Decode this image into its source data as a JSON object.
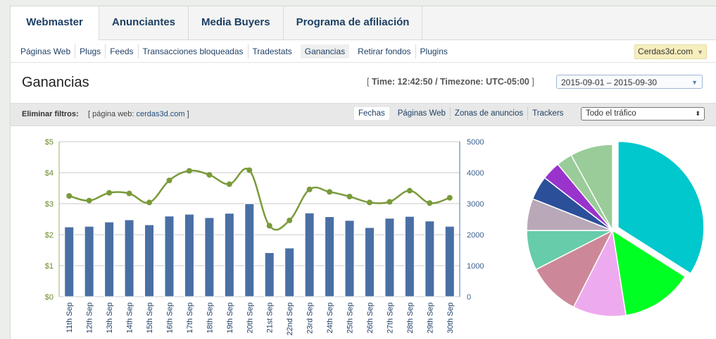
{
  "main_tabs": [
    "Webmaster",
    "Anunciantes",
    "Media Buyers",
    "Programa de afiliación"
  ],
  "sub_nav": [
    "Páginas Web",
    "Plugs",
    "Feeds",
    "Transacciones bloqueadas",
    "Tradestats",
    "Ganancias",
    "Retirar fondos",
    "Plugins"
  ],
  "sub_nav_active": "Ganancias",
  "domain_select": "Cerdas3d.com",
  "page_title": "Ganancias",
  "time_info": {
    "open": "[",
    "text": "Time: 12:42:50 / Timezone: UTC-05:00",
    "close": "]"
  },
  "date_range": "2015-09-01 – 2015-09-30",
  "filters": {
    "label": "Eliminar filtros:",
    "prefix": "[ página web:",
    "value": "cerdas3d.com",
    "suffix": "]"
  },
  "view_tabs": [
    "Fechas",
    "Páginas Web",
    "Zonas de anuncios",
    "Trackers"
  ],
  "traffic_select": "Todo el tráfico",
  "colors": {
    "bar": "#4a6fa5",
    "line": "#7a9a3a",
    "accent": "#1d3f63"
  },
  "chart_data": [
    {
      "type": "bar",
      "categories": [
        "11th Sep",
        "12th Sep",
        "13th Sep",
        "14th Sep",
        "15th Sep",
        "16th Sep",
        "17th Sep",
        "18th Sep",
        "19th Sep",
        "20th Sep",
        "21st Sep",
        "22nd Sep",
        "23rd Sep",
        "24th Sep",
        "25th Sep",
        "26th Sep",
        "27th Sep",
        "28th Sep",
        "29th Sep",
        "30th Sep"
      ],
      "series": [
        {
          "axis": "left",
          "type": "bar",
          "values": [
            2.25,
            2.27,
            2.41,
            2.48,
            2.32,
            2.6,
            2.66,
            2.55,
            2.69,
            3.0,
            1.42,
            1.57,
            2.7,
            2.58,
            2.46,
            2.23,
            2.53,
            2.59,
            2.44,
            2.27
          ]
        },
        {
          "axis": "right",
          "type": "line",
          "values": [
            3250,
            3100,
            3350,
            3330,
            3040,
            3750,
            4060,
            3930,
            3630,
            4080,
            2290,
            2460,
            3460,
            3380,
            3230,
            3040,
            3060,
            3420,
            3020,
            3190
          ]
        }
      ],
      "y_left": {
        "ticks": [
          "$0",
          "$1",
          "$2",
          "$3",
          "$4",
          "$5"
        ],
        "ylim": [
          0,
          5
        ]
      },
      "y_right": {
        "ticks": [
          "0",
          "1000",
          "2000",
          "3000",
          "4000",
          "5000"
        ],
        "ylim": [
          0,
          5000
        ]
      },
      "grid": true
    },
    {
      "type": "pie",
      "values": [
        34,
        13.5,
        10,
        10,
        7.5,
        6,
        4.5,
        3.5,
        3,
        8
      ],
      "colors": [
        "#00c8cc",
        "#00ff22",
        "#eeaaee",
        "#cc8899",
        "#66ccaa",
        "#b8a8b8",
        "#2c4f9a",
        "#9933cc",
        "#99cc99",
        "#99cc99"
      ],
      "exploded_index": 0,
      "value_note": "slice sizes estimated from wedge angles, no labels shown"
    }
  ]
}
